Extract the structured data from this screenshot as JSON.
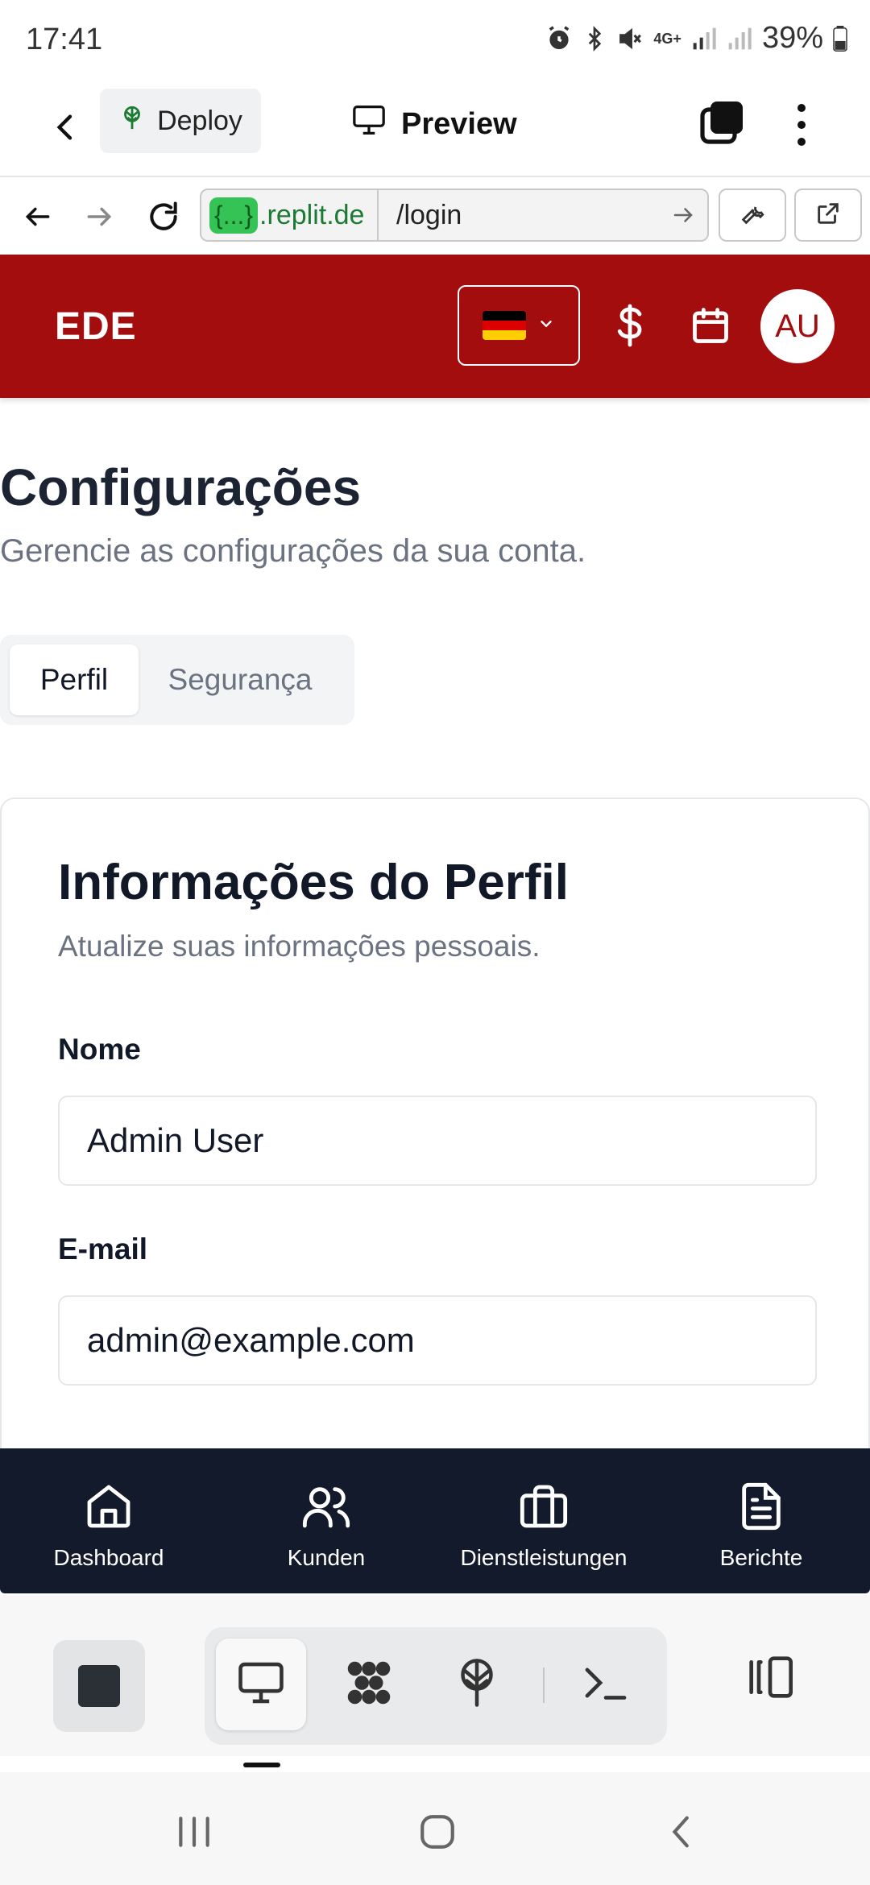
{
  "status_bar": {
    "time": "17:41",
    "network": "4G+",
    "battery": "39%"
  },
  "replit_bar": {
    "deploy_label": "Deploy",
    "preview_label": "Preview"
  },
  "url_bar": {
    "host_pill": "{...}",
    "host_domain": ".replit.de",
    "path": "/login"
  },
  "app_header": {
    "logo": "EDE",
    "language": "de",
    "avatar_initials": "AU",
    "brand_color": "#a30d0d"
  },
  "page": {
    "title": "Configurações",
    "subtitle": "Gerencie as configurações da sua conta."
  },
  "tabs": [
    {
      "label": "Perfil",
      "active": true
    },
    {
      "label": "Segurança",
      "active": false
    }
  ],
  "profile_card": {
    "title": "Informações do Perfil",
    "description": "Atualize suas informações pessoais.",
    "name_label": "Nome",
    "name_value": "Admin User",
    "email_label": "E-mail",
    "email_value": "admin@example.com"
  },
  "bottom_nav": [
    {
      "label": "Dashboard",
      "icon": "home-icon"
    },
    {
      "label": "Kunden",
      "icon": "users-icon"
    },
    {
      "label": "Dienstleistungen",
      "icon": "briefcase-icon"
    },
    {
      "label": "Berichte",
      "icon": "document-icon"
    }
  ]
}
